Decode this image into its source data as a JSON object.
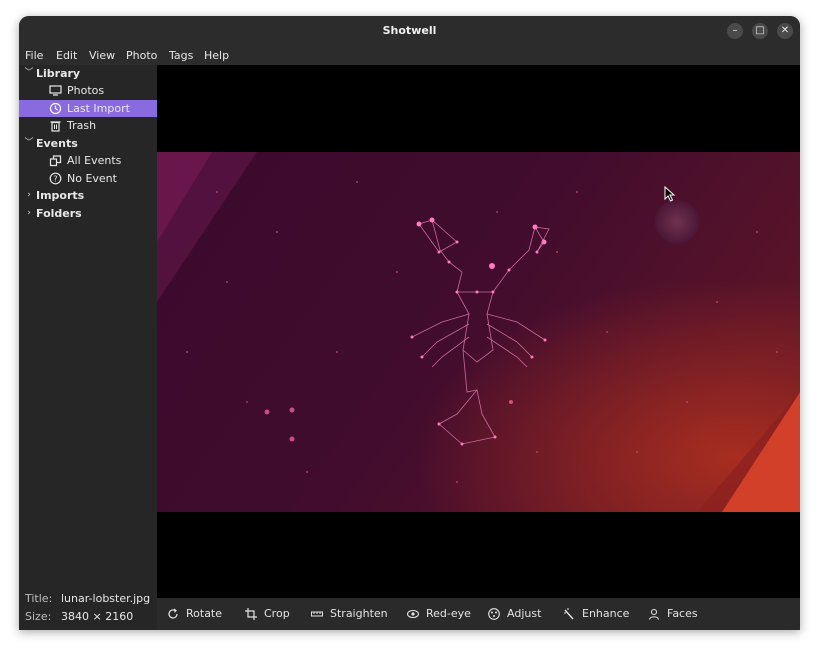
{
  "window": {
    "title": "Shotwell"
  },
  "menu": [
    "File",
    "Edit",
    "View",
    "Photo",
    "Tags",
    "Help"
  ],
  "sidebar": {
    "library": {
      "label": "Library",
      "items": [
        "Photos",
        "Last Import",
        "Trash"
      ],
      "selected": "Last Import"
    },
    "events": {
      "label": "Events",
      "items": [
        "All Events",
        "No Event"
      ]
    },
    "imports": {
      "label": "Imports"
    },
    "folders": {
      "label": "Folders"
    }
  },
  "info": {
    "title_key": "Title:",
    "title_value": "lunar-lobster.jpg",
    "size_key": "Size:",
    "size_value": "3840 × 2160"
  },
  "toolbar": {
    "rotate": "Rotate",
    "crop": "Crop",
    "straighten": "Straighten",
    "redeye": "Red-eye",
    "adjust": "Adjust",
    "enhance": "Enhance",
    "faces": "Faces"
  },
  "colors": {
    "selection": "#8a6adf",
    "photo_base": "#3a0b2a",
    "accent_orange": "#e3482a"
  }
}
